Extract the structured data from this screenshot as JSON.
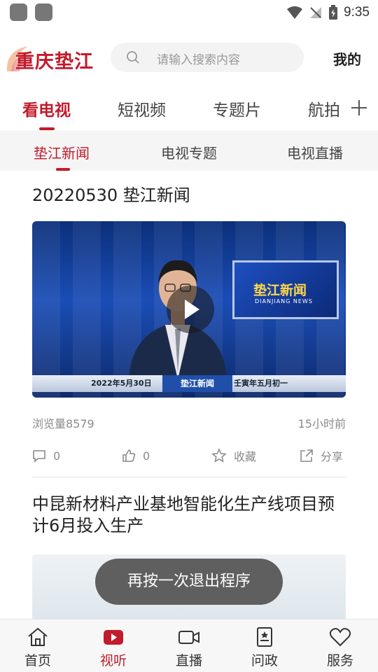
{
  "status_bar": {
    "time": "9:35"
  },
  "header": {
    "logo_text": "重庆垫江",
    "search_placeholder": "请输入搜索内容",
    "mine_label": "我的"
  },
  "main_tabs": [
    {
      "label": "看电视",
      "active": true
    },
    {
      "label": "短视频",
      "active": false
    },
    {
      "label": "专题片",
      "active": false
    },
    {
      "label": "航拍",
      "active": false
    }
  ],
  "sub_tabs": [
    {
      "label": "垫江新闻",
      "active": true
    },
    {
      "label": "电视专题",
      "active": false
    },
    {
      "label": "电视直播",
      "active": false
    }
  ],
  "feed": {
    "items": [
      {
        "title": "20220530 垫江新闻",
        "video": {
          "logo": "垫江新闻",
          "logo_sub": "DIANJIANG NEWS",
          "date": "2022年5月30日",
          "program": "垫江新闻",
          "lunar": "壬寅年五月初一"
        },
        "views": "浏览量8579",
        "time": "15小时前",
        "comments": "0",
        "likes": "0",
        "favorite_label": "收藏",
        "share_label": "分享"
      },
      {
        "title": "中昆新材料产业基地智能化生产线项目预计6月投入生产"
      }
    ]
  },
  "toast": {
    "text": "再按一次退出程序"
  },
  "bottom_nav": [
    {
      "label": "首页",
      "icon": "home-icon",
      "active": false
    },
    {
      "label": "视听",
      "icon": "video-play-icon",
      "active": true
    },
    {
      "label": "直播",
      "icon": "camera-icon",
      "active": false
    },
    {
      "label": "问政",
      "icon": "document-icon",
      "active": false
    },
    {
      "label": "服务",
      "icon": "heart-icon",
      "active": false
    }
  ],
  "colors": {
    "accent": "#c21b2b",
    "toast_bg": "#5f5f5f"
  }
}
